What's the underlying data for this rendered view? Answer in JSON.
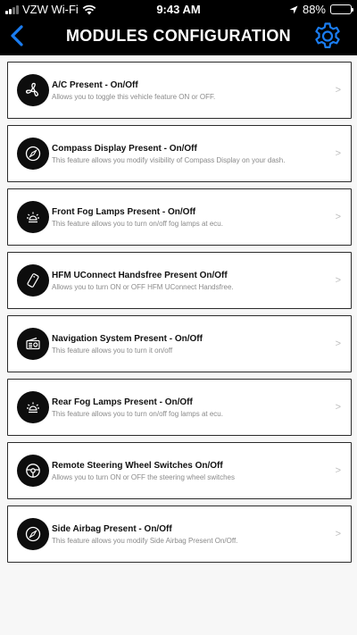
{
  "status_bar": {
    "carrier": "VZW Wi-Fi",
    "time": "9:43 AM",
    "battery": "88%",
    "battery_level": 0.88
  },
  "header": {
    "title": "MODULES CONFIGURATION",
    "back_icon": "chevron-left-icon",
    "settings_icon": "gear-icon",
    "accent_color": "#1a7cf0"
  },
  "modules": [
    {
      "title": "A/C Present - On/Off",
      "description": "Allows you to toggle this vehicle feature ON or OFF.",
      "icon": "fan-icon",
      "chevron": ">"
    },
    {
      "title": "Compass Display Present - On/Off",
      "description": "This feature allows you modify visibility of Compass Display on your dash.",
      "icon": "compass-icon",
      "chevron": ">"
    },
    {
      "title": "Front Fog Lamps Present - On/Off",
      "description": "This feature allows you to turn on/off fog lamps at ecu.",
      "icon": "fog-lamp-icon",
      "chevron": ">"
    },
    {
      "title": "HFM UConnect Handsfree Present On/Off",
      "description": "Allows you to turn ON or OFF HFM UConnect Handsfree.",
      "icon": "phone-icon",
      "chevron": ">"
    },
    {
      "title": "Navigation System Present - On/Off",
      "description": "This feature allows you to turn it on/off",
      "icon": "radio-icon",
      "chevron": ">"
    },
    {
      "title": "Rear Fog Lamps Present - On/Off",
      "description": "This feature allows you to turn on/off fog lamps at ecu.",
      "icon": "fog-lamp-icon",
      "chevron": ">"
    },
    {
      "title": "Remote Steering Wheel Switches On/Off",
      "description": "Allows you to turn ON or OFF the steering wheel switches",
      "icon": "steering-wheel-icon",
      "chevron": ">"
    },
    {
      "title": "Side Airbag Present - On/Off",
      "description": "This feature allows you modify Side Airbag Present On/Off.",
      "icon": "compass-icon",
      "chevron": ">"
    }
  ]
}
